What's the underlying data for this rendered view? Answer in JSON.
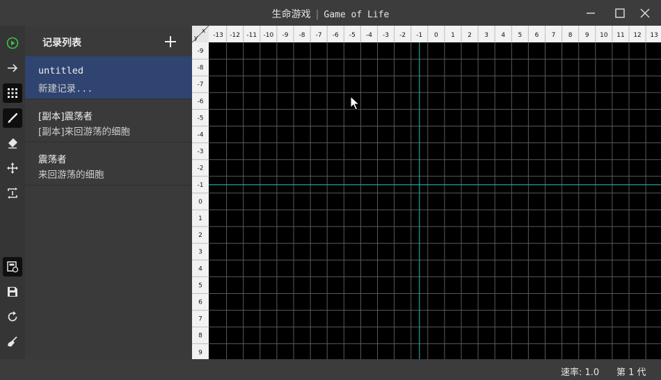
{
  "window": {
    "title_cn": "生命游戏",
    "title_sep": "|",
    "title_en": "Game of Life"
  },
  "sidebar": {
    "title": "记录列表",
    "add_label": "+",
    "records": [
      {
        "name": "untitled",
        "description": "新建记录..."
      },
      {
        "name": "[副本]震荡者",
        "description": "[副本]来回游荡的细胞"
      },
      {
        "name": "震荡者",
        "description": "来回游荡的细胞"
      }
    ]
  },
  "toolbar": {
    "tools": [
      {
        "name": "play-icon",
        "active": false
      },
      {
        "name": "step-arrow-icon",
        "active": false
      },
      {
        "name": "grid-icon",
        "active": true
      },
      {
        "name": "brush-icon",
        "active": true
      },
      {
        "name": "eraser-icon",
        "active": false
      },
      {
        "name": "move-icon",
        "active": false
      },
      {
        "name": "reset-frame-icon",
        "active": false
      }
    ],
    "bottom_tools": [
      {
        "name": "save-as-icon",
        "active": true
      },
      {
        "name": "save-icon",
        "active": false
      },
      {
        "name": "refresh-icon",
        "active": false
      },
      {
        "name": "clean-broom-icon",
        "active": false
      }
    ]
  },
  "grid": {
    "corner_y": "y",
    "corner_x": "x",
    "x_labels": [
      "-13",
      "-12",
      "-11",
      "-10",
      "-9",
      "-8",
      "-7",
      "-6",
      "-5",
      "-4",
      "-3",
      "-2",
      "-1",
      "0",
      "1",
      "2",
      "3",
      "4",
      "5",
      "6",
      "7",
      "8",
      "9",
      "10",
      "11",
      "12",
      "13"
    ],
    "y_labels": [
      "-9",
      "-8",
      "-7",
      "-6",
      "-5",
      "-4",
      "-3",
      "-2",
      "-1",
      "0",
      "1",
      "2",
      "3",
      "4",
      "5",
      "6",
      "7",
      "8",
      "9"
    ]
  },
  "status": {
    "speed": "速率: 1.0",
    "generation": "第 1 代"
  },
  "colors": {
    "accent_selected": "#2f4470",
    "axis_line": "#1fa5a5",
    "grid_line": "#5a5a5a"
  }
}
